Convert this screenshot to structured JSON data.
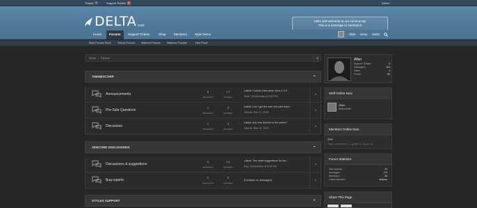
{
  "topbar": {
    "expiry_label": "Expiry",
    "expiry_count": "0",
    "tickets_label": "Support Tickets",
    "tickets_count": "0",
    "admin_label": "Admin"
  },
  "header": {
    "logo_text": "DELTA",
    "logo_sub": "Dark",
    "welcome_line1": "Hello and welcome to our community!",
    "welcome_line2": "This is a message to members!"
  },
  "nav": {
    "tabs": [
      "Home",
      "Forums",
      "Support Tickets",
      "Shop",
      "Members",
      "Style Demo"
    ],
    "user": "Allan",
    "inbox": "Inbox",
    "alerts": "Alerts"
  },
  "subnav": {
    "links": [
      "Mark Forums Read",
      "Search Forums",
      "Watched Forums",
      "Watched Threads",
      "New Posts"
    ]
  },
  "breadcrumb": {
    "home": "Home",
    "sep": "›",
    "forums": "Forums"
  },
  "categories": [
    {
      "title": "THEMESCORP",
      "forums": [
        {
          "title": "Announcements",
          "discussions": "8",
          "messages": "17",
          "latest_prefix": "Latest:",
          "latest": "Custom Username Icons 1.0.0",
          "meta": "Allan, Wednesday at 9:52 PM"
        },
        {
          "title": "Pre-Sale Questions",
          "discussions": "1",
          "messages": "3",
          "latest_prefix": "Latest:",
          "latest": "Can I get the user info plus them...",
          "meta": "Wanda, Mar 12, 2015"
        },
        {
          "title": "Discussion",
          "discussions": "1",
          "messages": "4",
          "latest_prefix": "Latest:",
          "latest": "Any new themes in the works?",
          "meta": "Wanda, Mar 12, 2015"
        }
      ]
    },
    {
      "title": "XENCORE DISCUSSIONS",
      "forums": [
        {
          "title": "Discussions & suggestions",
          "discussions": "3",
          "messages": "13",
          "latest_prefix": "Latest:",
          "latest": "Two more suggestions for fan...",
          "meta": "Roy, Wednesday at 6:43 PM"
        },
        {
          "title": "Bug reports",
          "discussions": "0",
          "messages": "0",
          "latest_prefix": "",
          "latest": "(Contains no messages)",
          "meta": ""
        }
      ]
    },
    {
      "title": "STYLES SUPPORT",
      "forums": []
    }
  ],
  "stat_labels": {
    "discussions": "discussions",
    "messages": "messages"
  },
  "sidebar": {
    "profile": {
      "name": "Allan",
      "stats": [
        {
          "label": "Support Tickets:",
          "value": "0"
        },
        {
          "label": "Messages:",
          "value": "102"
        },
        {
          "label": "Likes:",
          "value": "4"
        },
        {
          "label": "Points:",
          "value": "56"
        }
      ]
    },
    "staff_title": "Staff Online Now",
    "staff_name": "Allan",
    "staff_role": "Webmaster",
    "members_title": "Members Online Now",
    "members_name": "Allan",
    "members_total": "Total: 1 (members: 1, guests: 0, robots: 0)",
    "stats_title": "Forum Statistics",
    "forum_stats": [
      {
        "label": "Discussions:",
        "value": "44"
      },
      {
        "label": "Messages:",
        "value": "174"
      },
      {
        "label": "Members:",
        "value": "56"
      },
      {
        "label": "Latest Member:",
        "value": "celboss"
      }
    ],
    "share_title": "Share This Page"
  },
  "colors": {
    "header": "#5a87a8",
    "nav": "#4d7596",
    "bg": "#262626"
  }
}
